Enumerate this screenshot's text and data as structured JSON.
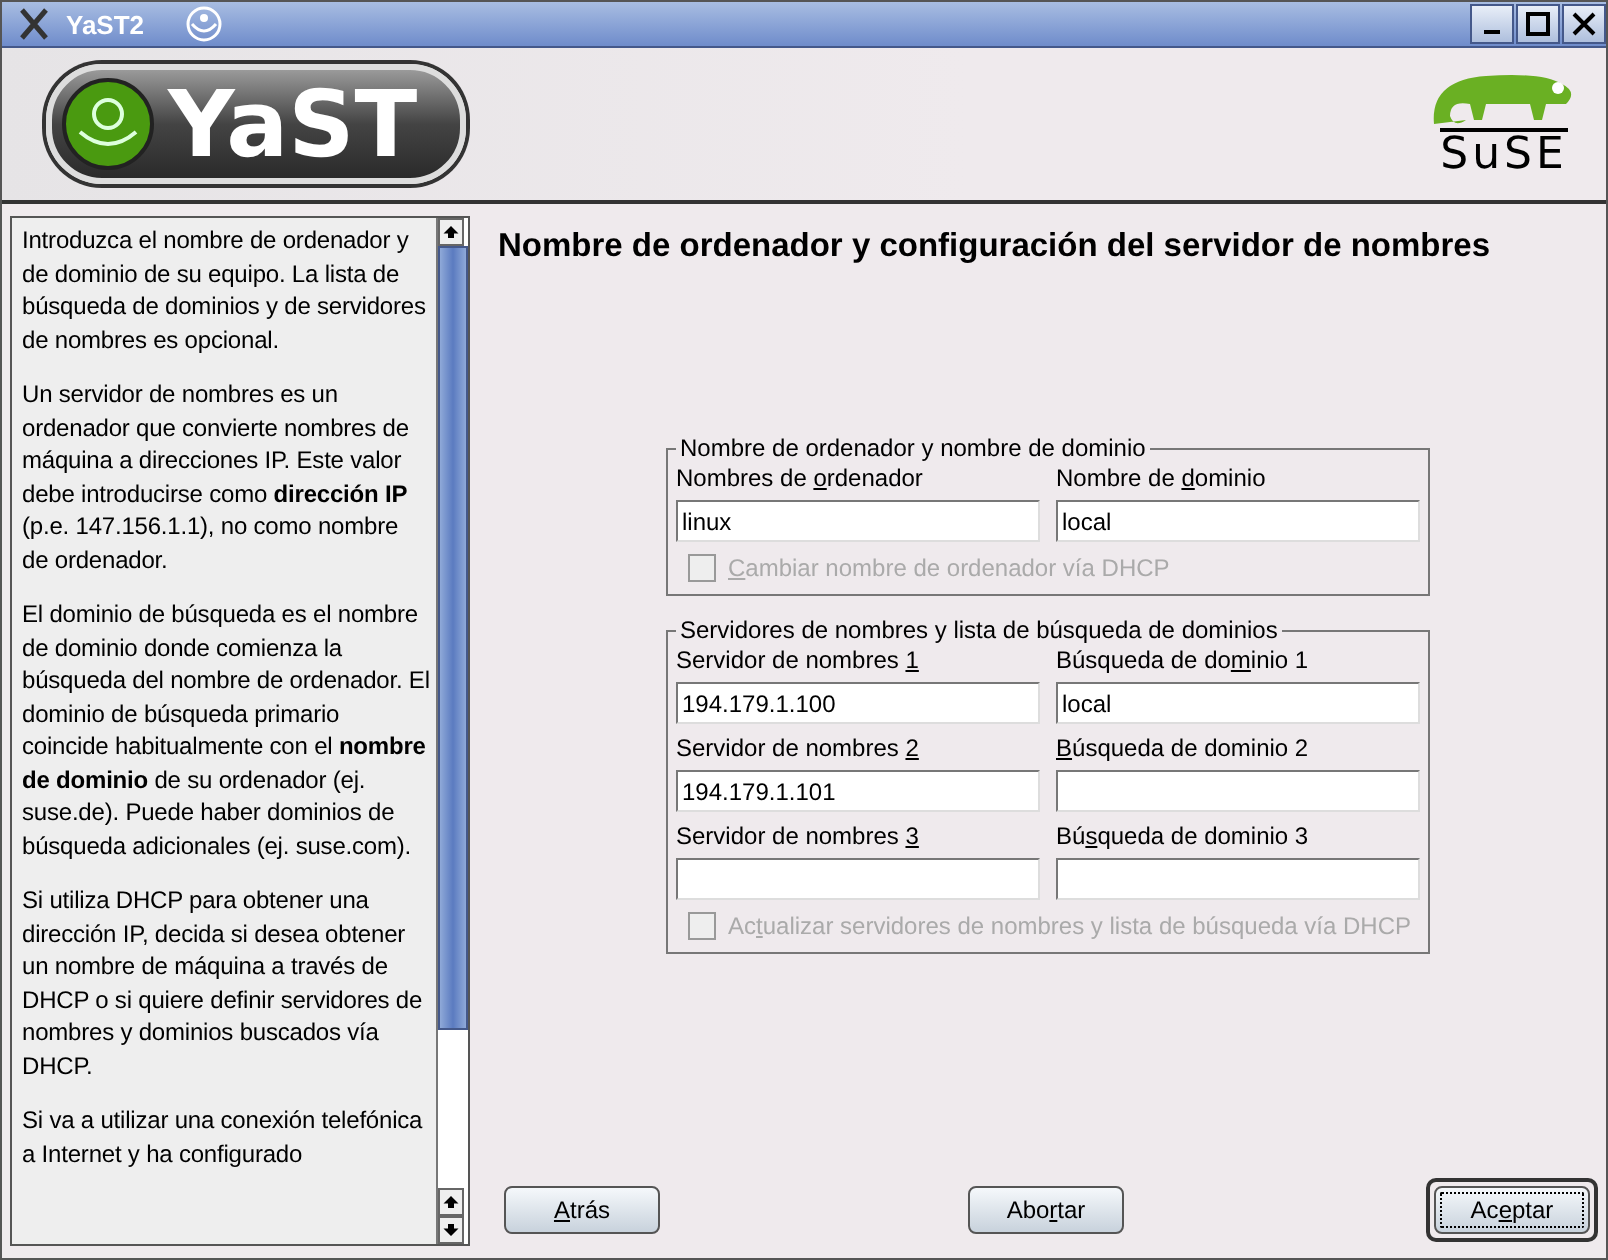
{
  "window": {
    "title": "YaST2"
  },
  "header": {
    "logo_text": "YaST",
    "brand_text": "SuSE"
  },
  "help": {
    "paragraphs": [
      "Introduzca el nombre de ordenador y de dominio de su equipo. La lista de búsqueda de dominios y de servidores de nombres es opcional.",
      "Un servidor de nombres es un ordenador que convierte nombres de máquina a direcciones IP. Este valor debe introducirse como **dirección IP** (p.e. 147.156.1.1), no como nombre de ordenador.",
      "El dominio de búsqueda es el nombre de dominio donde comienza la búsqueda del nombre de ordenador. El dominio de búsqueda primario coincide habitualmente con el **nombre de dominio** de su ordenador (ej. suse.de). Puede haber dominios de búsqueda adicionales (ej. suse.com).",
      "Si utiliza DHCP para obtener una dirección IP, decida si desea obtener un nombre de máquina a través de DHCP o si quiere definir servidores de nombres y dominios buscados vía DHCP.",
      "Si va a utilizar una conexión telefónica a Internet y ha configurado"
    ]
  },
  "heading": "Nombre de ordenador y configuración del servidor de nombres",
  "groups": [
    {
      "title": "Nombre de ordenador y nombre de dominio",
      "fields": [
        {
          "label": {
            "pre": "Nombres de ",
            "key": "o",
            "post": "rdenador"
          },
          "value": "linux"
        },
        {
          "label": {
            "pre": "Nombre de ",
            "key": "d",
            "post": "ominio"
          },
          "value": "local"
        }
      ],
      "checkbox": {
        "label": {
          "key": "C",
          "post": "ambiar nombre de ordenador vía DHCP"
        },
        "checked": false,
        "disabled": true
      }
    },
    {
      "title": "Servidores de nombres y lista de búsqueda de dominios",
      "fields": [
        {
          "label": {
            "pre": "Servidor de nombres ",
            "key": "1"
          },
          "value": "194.179.1.100"
        },
        {
          "label": {
            "pre": "Búsqueda de do",
            "key": "m",
            "post": "inio 1"
          },
          "value": "local"
        },
        {
          "label": {
            "pre": "Servidor de nombres ",
            "key": "2"
          },
          "value": "194.179.1.101"
        },
        {
          "label": {
            "key": "B",
            "post": "úsqueda de dominio 2"
          }
        },
        {
          "label": {
            "pre": "Servidor de nombres ",
            "key": "3"
          }
        },
        {
          "label": {
            "pre": "Bú",
            "key": "s",
            "post": "queda de dominio 3"
          }
        }
      ],
      "checkbox": {
        "label": {
          "pre": "Ac",
          "key": "t",
          "post": "ualizar servidores de nombres y lista de búsqueda vía DHCP"
        },
        "checked": false,
        "disabled": true
      }
    }
  ],
  "buttons": [
    {
      "label": {
        "key": "A",
        "post": "trás"
      },
      "default": false
    },
    {
      "label": {
        "pre": "Abo",
        "key": "r",
        "post": "tar"
      },
      "default": false
    },
    {
      "label": {
        "pre": "Ac",
        "key": "e",
        "post": "ptar"
      },
      "default": true
    }
  ]
}
